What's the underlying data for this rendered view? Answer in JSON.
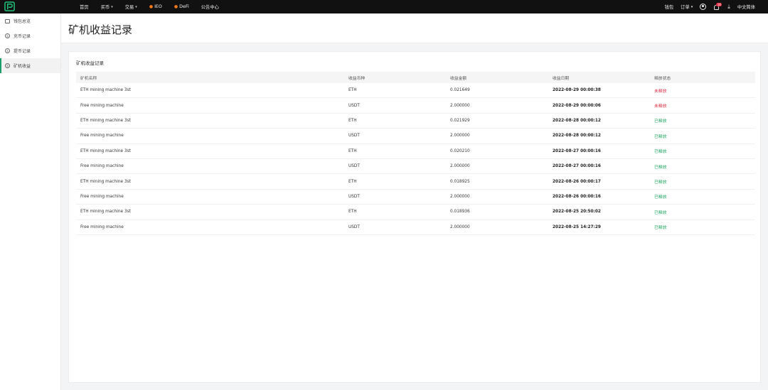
{
  "topbar": {
    "nav": [
      {
        "label": "首页",
        "has_caret": false
      },
      {
        "label": "买币",
        "has_caret": true
      },
      {
        "label": "交易",
        "has_caret": true
      },
      {
        "label": "IEO",
        "has_flame": true
      },
      {
        "label": "DeFi",
        "has_flame": true
      },
      {
        "label": "公告中心",
        "has_caret": false
      }
    ],
    "right": {
      "wallet": "钱包",
      "orders": "订单",
      "notification_count": "18",
      "language": "中文简体"
    }
  },
  "sidebar": {
    "items": [
      {
        "label": "钱包总览",
        "icon": "wallet-icon",
        "active": false
      },
      {
        "label": "充币记录",
        "icon": "coin-icon",
        "active": false
      },
      {
        "label": "提币记录",
        "icon": "coin-icon",
        "active": false
      },
      {
        "label": "矿机收益",
        "icon": "coin-icon",
        "active": true
      }
    ]
  },
  "page": {
    "title": "矿机收益记录",
    "card_title": "矿机收益记录"
  },
  "table": {
    "columns": [
      "矿机名称",
      "收益币种",
      "收益金额",
      "收益日期",
      "释放状态"
    ],
    "rows": [
      {
        "name": "ETH mining machine 3st",
        "currency": "ETH",
        "amount": "0.021649",
        "date": "2022-08-29 00:00:38",
        "status": "未释放",
        "released": false
      },
      {
        "name": "Free mining machine",
        "currency": "USDT",
        "amount": "2.000000",
        "date": "2022-08-29 00:00:06",
        "status": "未释放",
        "released": false
      },
      {
        "name": "ETH mining machine 3st",
        "currency": "ETH",
        "amount": "0.021929",
        "date": "2022-08-28 00:00:12",
        "status": "已释放",
        "released": true
      },
      {
        "name": "Free mining machine",
        "currency": "USDT",
        "amount": "2.000000",
        "date": "2022-08-28 00:00:12",
        "status": "已释放",
        "released": true
      },
      {
        "name": "ETH mining machine 3st",
        "currency": "ETH",
        "amount": "0.020210",
        "date": "2022-08-27 00:00:16",
        "status": "已释放",
        "released": true
      },
      {
        "name": "Free mining machine",
        "currency": "USDT",
        "amount": "2.000000",
        "date": "2022-08-27 00:00:16",
        "status": "已释放",
        "released": true
      },
      {
        "name": "ETH mining machine 3st",
        "currency": "ETH",
        "amount": "0.018925",
        "date": "2022-08-26 00:00:17",
        "status": "已释放",
        "released": true
      },
      {
        "name": "Free mining machine",
        "currency": "USDT",
        "amount": "2.000000",
        "date": "2022-08-26 00:00:16",
        "status": "已释放",
        "released": true
      },
      {
        "name": "ETH mining machine 3st",
        "currency": "ETH",
        "amount": "0.018936",
        "date": "2022-08-25 20:50:02",
        "status": "已释放",
        "released": true
      },
      {
        "name": "Free mining machine",
        "currency": "USDT",
        "amount": "2.000000",
        "date": "2022-08-25 14:27:29",
        "status": "已释放",
        "released": true
      }
    ]
  },
  "colors": {
    "accent": "#1b9e6c",
    "released": "#17a35b",
    "unreleased": "#e0243a",
    "topbar_bg": "#111111"
  }
}
